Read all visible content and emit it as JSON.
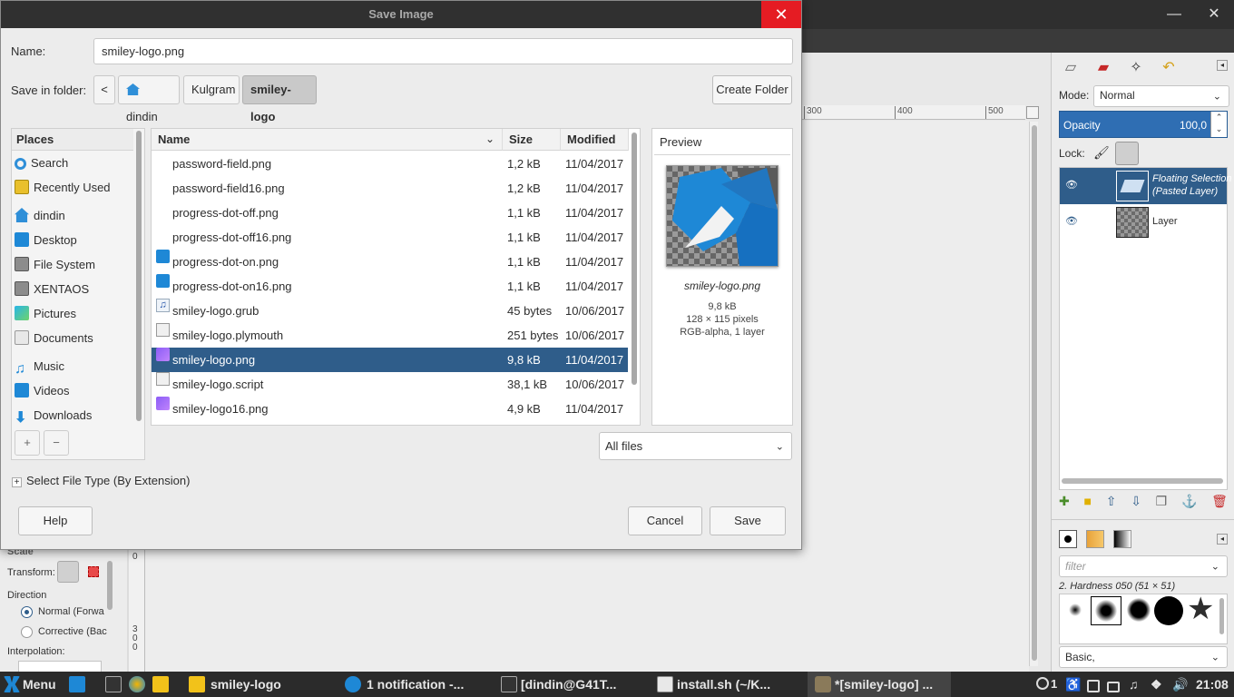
{
  "dialog": {
    "title": "Save Image",
    "close_glyph": "✕",
    "name_label": "Name:",
    "name_value": "smiley-logo.png",
    "folder_label": "Save in folder:",
    "back_glyph": "<",
    "breadcrumbs": [
      "dindin",
      "Kulgram",
      "smiley-logo"
    ],
    "create_folder": "Create Folder",
    "places_header": "Places",
    "places": [
      {
        "label": "Search",
        "icon": "search-icon"
      },
      {
        "label": "Recently Used",
        "icon": "recent-icon"
      },
      {
        "label": "dindin",
        "icon": "home-icon"
      },
      {
        "label": "Desktop",
        "icon": "desktop-icon"
      },
      {
        "label": "File System",
        "icon": "harddisk-icon"
      },
      {
        "label": "XENTAOS",
        "icon": "harddisk-icon"
      },
      {
        "label": "Pictures",
        "icon": "pictures-folder-icon"
      },
      {
        "label": "Documents",
        "icon": "documents-folder-icon"
      },
      {
        "label": "Music",
        "icon": "music-icon"
      },
      {
        "label": "Videos",
        "icon": "videos-folder-icon"
      },
      {
        "label": "Downloads",
        "icon": "downloads-icon"
      }
    ],
    "places_add": "+",
    "places_remove": "−",
    "columns": {
      "name": "Name",
      "size": "Size",
      "modified": "Modified"
    },
    "files": [
      {
        "name": "password-field.png",
        "size": "1,2 kB",
        "modified": "11/04/2017",
        "icon": "none"
      },
      {
        "name": "password-field16.png",
        "size": "1,2 kB",
        "modified": "11/04/2017",
        "icon": "none"
      },
      {
        "name": "progress-dot-off.png",
        "size": "1,1 kB",
        "modified": "11/04/2017",
        "icon": "none"
      },
      {
        "name": "progress-dot-off16.png",
        "size": "1,1 kB",
        "modified": "11/04/2017",
        "icon": "none"
      },
      {
        "name": "progress-dot-on.png",
        "size": "1,1 kB",
        "modified": "11/04/2017",
        "icon": "blue-square-icon"
      },
      {
        "name": "progress-dot-on16.png",
        "size": "1,1 kB",
        "modified": "11/04/2017",
        "icon": "blue-square-icon"
      },
      {
        "name": "smiley-logo.grub",
        "size": "45 bytes",
        "modified": "10/06/2017",
        "icon": "music-file-icon"
      },
      {
        "name": "smiley-logo.plymouth",
        "size": "251 bytes",
        "modified": "10/06/2017",
        "icon": "text-file-icon"
      },
      {
        "name": "smiley-logo.png",
        "size": "9,8 kB",
        "modified": "11/04/2017",
        "icon": "image-file-icon",
        "selected": true
      },
      {
        "name": "smiley-logo.script",
        "size": "38,1 kB",
        "modified": "10/06/2017",
        "icon": "text-file-icon"
      },
      {
        "name": "smiley-logo16.png",
        "size": "4,9 kB",
        "modified": "11/04/2017",
        "icon": "image-file-icon"
      }
    ],
    "preview": {
      "header": "Preview",
      "filename": "smiley-logo.png",
      "size": "9,8 kB",
      "dimensions": "128 × 115 pixels",
      "info": "RGB-alpha, 1 layer"
    },
    "filter_value": "All files",
    "file_type_expander": "Select File Type (By Extension)",
    "help": "Help",
    "cancel": "Cancel",
    "save": "Save"
  },
  "gimp": {
    "ruler_ticks": [
      "300",
      "400",
      "500"
    ],
    "dock": {
      "mode_label": "Mode:",
      "mode_value": "Normal",
      "opacity_label": "Opacity",
      "opacity_value": "100,0",
      "lock_label": "Lock:",
      "layers": [
        {
          "name": "Floating Selection\n(Pasted Layer)",
          "selected": true
        },
        {
          "name": "Layer",
          "selected": false
        }
      ],
      "brush_filter_placeholder": "filter",
      "brush_name": "2. Hardness 050 (51 × 51)",
      "brush_preset": "Basic,"
    },
    "tool_options": {
      "scale": "Scale",
      "transform_label": "Transform:",
      "direction_label": "Direction",
      "normal": "Normal (Forwa",
      "corrective": "Corrective (Bac",
      "interpolation": "Interpolation:"
    },
    "left_ruler": [
      "0",
      "3",
      "0",
      "0"
    ]
  },
  "taskbar": {
    "menu": "Menu",
    "tasks": [
      "smiley-logo",
      "1 notification -...",
      "[dindin@G41T...",
      "install.sh (~/K...",
      "*[smiley-logo] ..."
    ],
    "tray_count": "1",
    "clock": "21:08"
  },
  "colors": {
    "accent": "#2f5d8a",
    "opacity_bar": "#2f6eb3",
    "close_red": "#e51c23",
    "titlebar": "#303030",
    "taskbar": "#2b2b2b"
  }
}
